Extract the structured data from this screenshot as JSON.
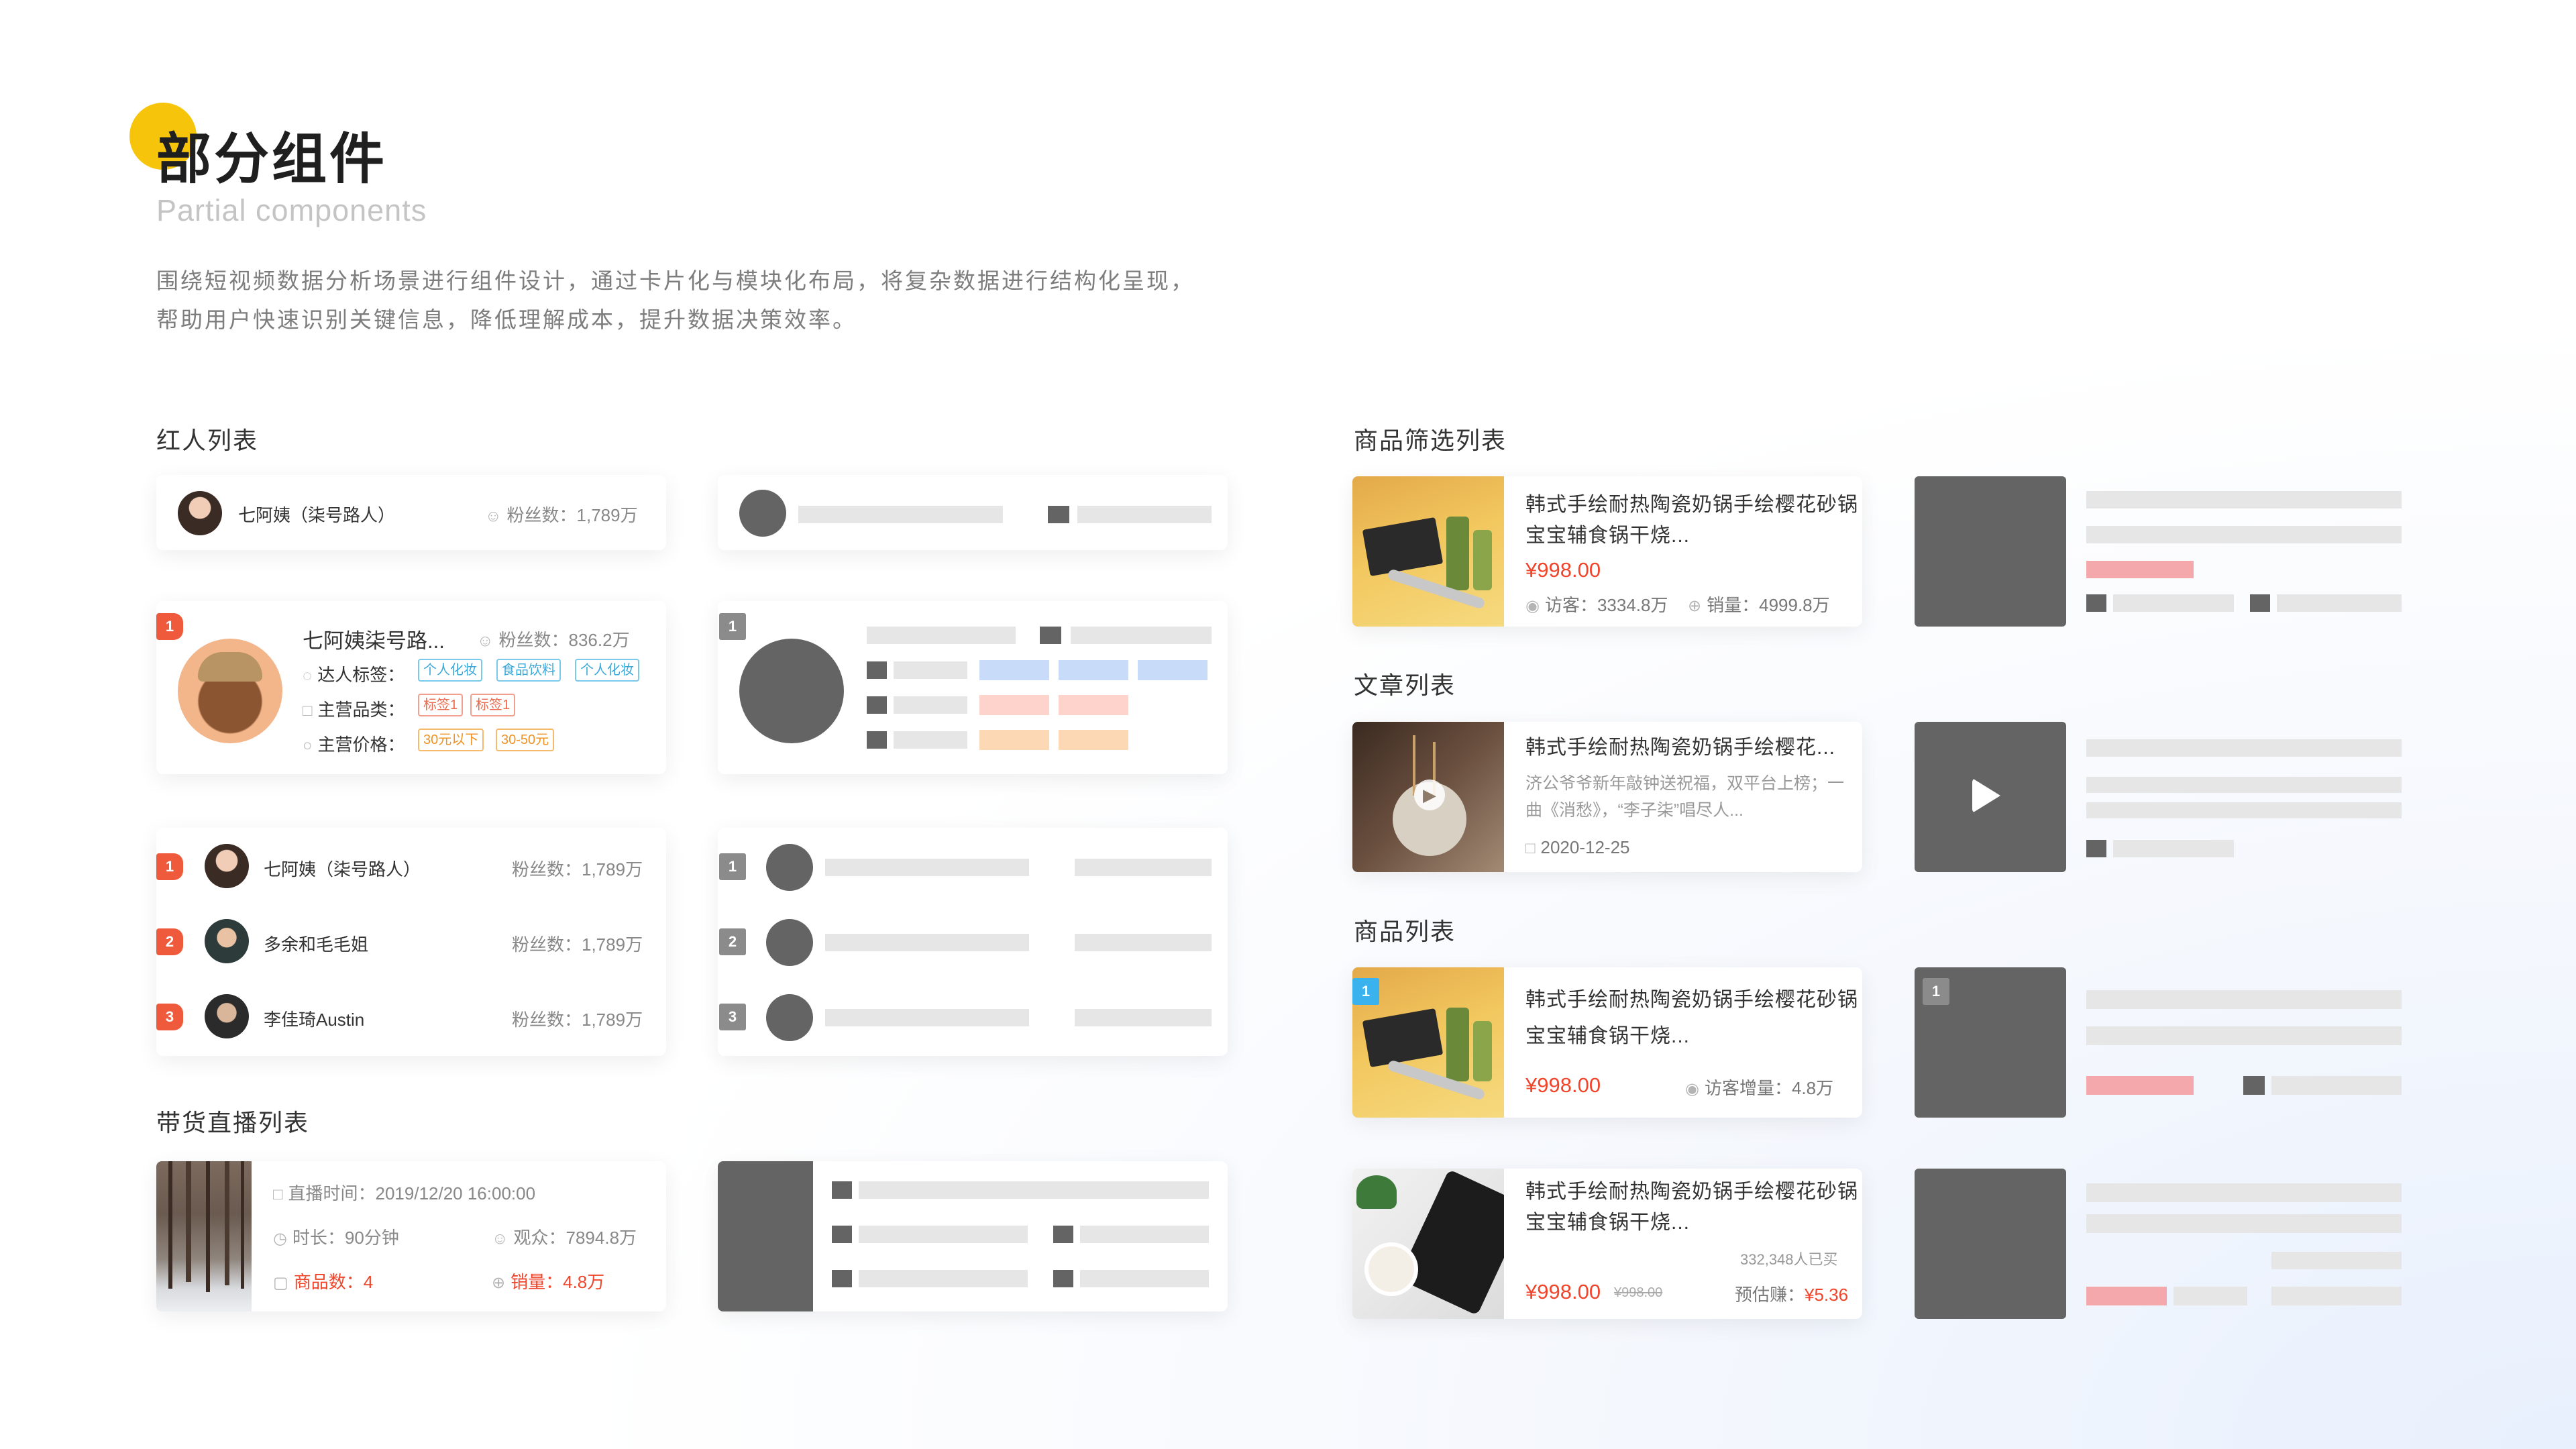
{
  "header": {
    "title": "部分组件",
    "subtitle": "Partial components",
    "desc_line1": "围绕短视频数据分析场景进行组件设计，通过卡片化与模块化布局，将复杂数据进行结构化呈现，",
    "desc_line2": "帮助用户快速识别关键信息，降低理解成本，提升数据决策效率。"
  },
  "sections": {
    "influencer": "红人列表",
    "live": "带货直播列表",
    "goods_filter": "商品筛选列表",
    "article": "文章列表",
    "goods": "商品列表"
  },
  "influencer_simple": {
    "name": "七阿姨（柒号路人）",
    "fans": "粉丝数：1,789万"
  },
  "influencer_detail": {
    "rank": "1",
    "name": "七阿姨柒号路...",
    "fans": "粉丝数：836.2万",
    "tag_label": "达人标签：",
    "tags": [
      "个人化妆",
      "食品饮料",
      "个人化妆"
    ],
    "category_label": "主营品类：",
    "categories": [
      "标签1",
      "标签1"
    ],
    "price_label": "主营价格：",
    "prices": [
      "30元以下",
      "30-50元"
    ]
  },
  "influencer_rank": [
    {
      "rank": "1",
      "name": "七阿姨（柒号路人）",
      "fans": "粉丝数：1,789万"
    },
    {
      "rank": "2",
      "name": "多余和毛毛姐",
      "fans": "粉丝数：1,789万"
    },
    {
      "rank": "3",
      "name": "李佳琦Austin",
      "fans": "粉丝数：1,789万"
    }
  ],
  "skeleton_ranks": [
    "1",
    "2",
    "3"
  ],
  "live": {
    "time": "直播时间：2019/12/20 16:00:00",
    "duration": "时长：90分钟",
    "viewers": "观众：7894.8万",
    "goods_count": "商品数：4",
    "sales": "销量：4.8万"
  },
  "goods_filter": {
    "title": "韩式手绘耐热陶瓷奶锅手绘樱花砂锅宝宝辅食锅干烧...",
    "price": "¥998.00",
    "visitors": "访客：3334.8万",
    "sales": "销量：4999.8万"
  },
  "article": {
    "title": "韩式手绘耐热陶瓷奶锅手绘樱花...",
    "summary": "济公爷爷新年敲钟送祝福，双平台上榜；一曲《消愁》，“李子柒”唱尽人...",
    "date": "2020-12-25"
  },
  "goods1": {
    "rank": "1",
    "title": "韩式手绘耐热陶瓷奶锅手绘樱花砂锅宝宝辅食锅干烧...",
    "price": "¥998.00",
    "visitor_growth": "访客增量：4.8万"
  },
  "goods2": {
    "title": "韩式手绘耐热陶瓷奶锅手绘樱花砂锅宝宝辅食锅干烧...",
    "bought": "332,348人已买",
    "price": "¥998.00",
    "orig_price": "¥998.00",
    "earn_label": "预估赚：",
    "earn": "¥5.36"
  },
  "skeleton_goods_rank": "1",
  "colors": {
    "accent": "#f6c50b",
    "price": "#f0452b",
    "skeleton_dark": "#646464",
    "skeleton_light": "#e6e6e6"
  },
  "icons": [
    "fans-icon",
    "tag-icon",
    "category-icon",
    "price-icon",
    "calendar-icon",
    "clock-icon",
    "viewers-icon",
    "bag-icon",
    "cart-icon",
    "eye-icon",
    "play-icon"
  ]
}
